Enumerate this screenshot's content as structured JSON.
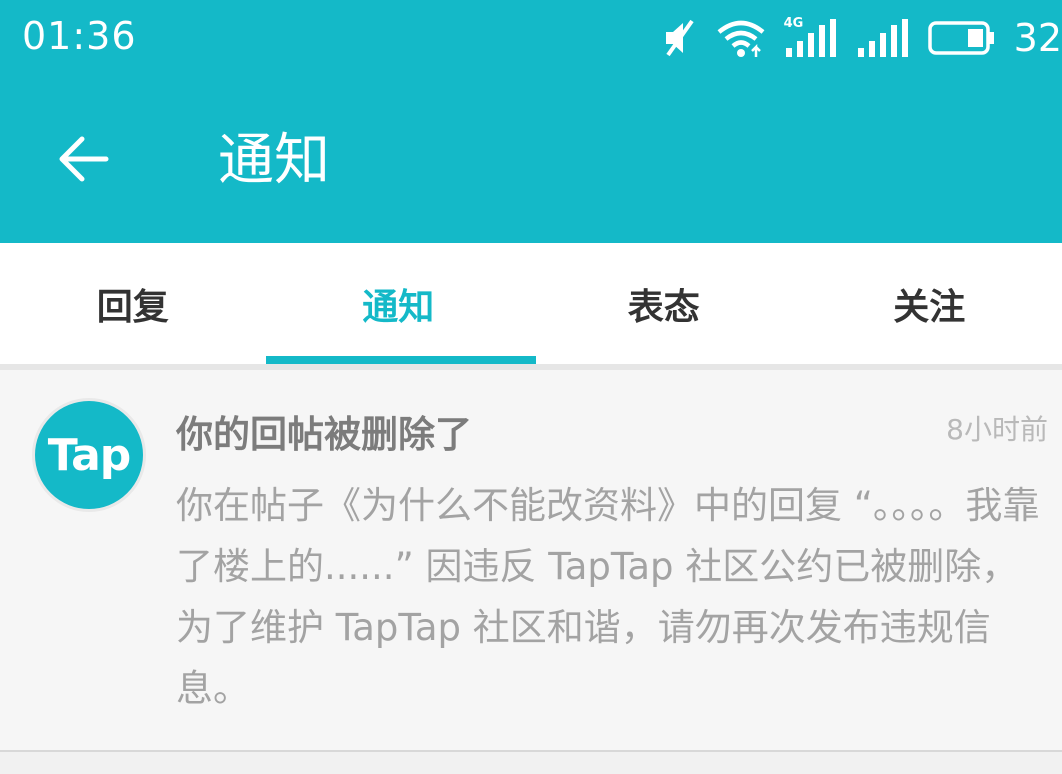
{
  "status_bar": {
    "time": "01:36",
    "battery_percent": "32",
    "network": "4G",
    "icons": [
      "mute-icon",
      "wifi-icon",
      "signal-4g-icon",
      "signal-icon",
      "battery-icon"
    ]
  },
  "app_bar": {
    "title": "通知",
    "back_icon": "arrow-left-icon"
  },
  "tabs": [
    {
      "label": "回复",
      "active": false
    },
    {
      "label": "通知",
      "active": true
    },
    {
      "label": "表态",
      "active": false
    },
    {
      "label": "关注",
      "active": false
    }
  ],
  "notification": {
    "avatar_text": "Tap",
    "title": "你的回帖被删除了",
    "time": "8小时前",
    "body": "你在帖子《为什么不能改资料》中的回复 “。。。。我靠了楼上的......” 因违反 TapTap 社区公约已被删除，为了维护 TapTap 社区和谐，请勿再次发布违规信息。"
  },
  "colors": {
    "accent": "#14b9c8",
    "title_text": "#7c7c7c",
    "body_text": "#a3a3a3"
  }
}
